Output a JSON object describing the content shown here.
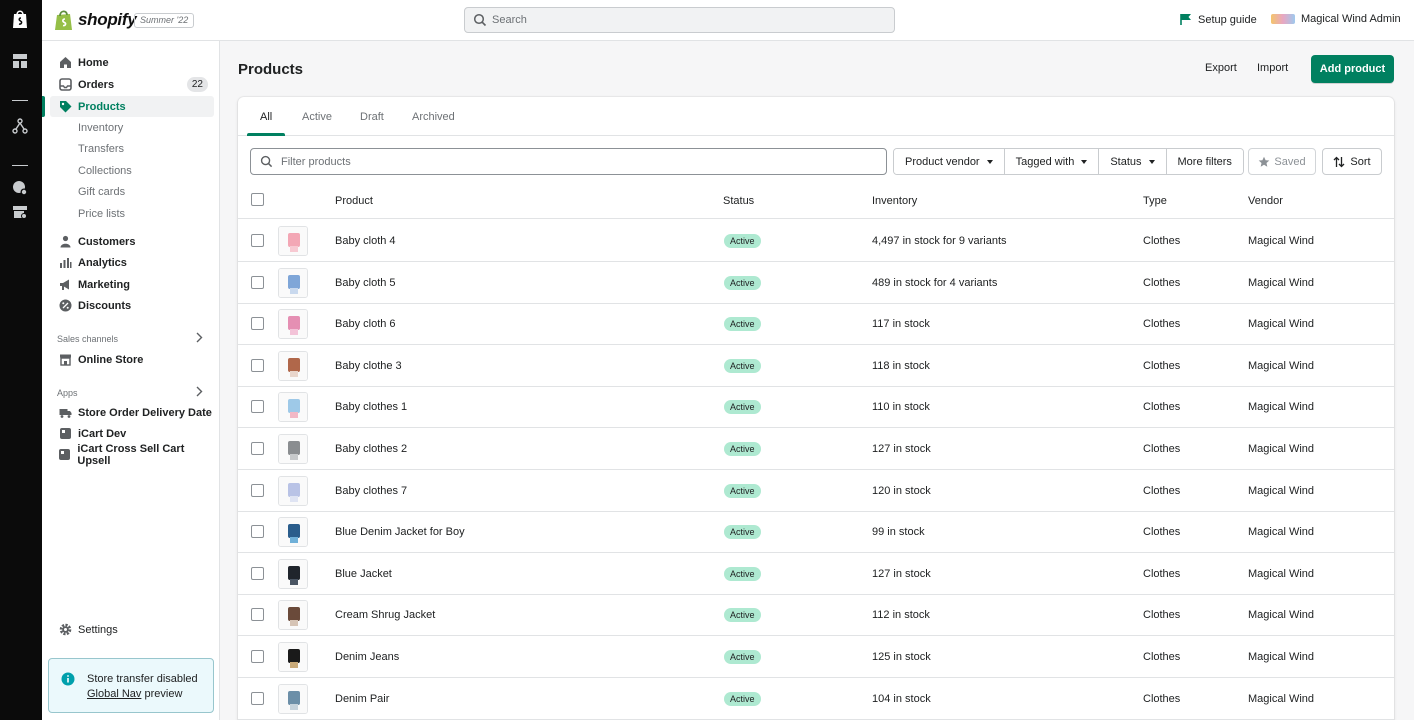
{
  "topbar": {
    "brand": "shopify",
    "edition": "Summer '22",
    "search_placeholder": "Search",
    "setup_guide": "Setup guide",
    "store_name": "Magical Wind Admin"
  },
  "sidebar": {
    "nav": [
      {
        "label": "Home",
        "icon": "home-icon"
      },
      {
        "label": "Orders",
        "icon": "orders-icon",
        "badge": "22"
      },
      {
        "label": "Products",
        "icon": "tag-icon",
        "active": true
      }
    ],
    "product_sub": [
      "Inventory",
      "Transfers",
      "Collections",
      "Gift cards",
      "Price lists"
    ],
    "nav2": [
      {
        "label": "Customers",
        "icon": "person-icon"
      },
      {
        "label": "Analytics",
        "icon": "bar-chart-icon"
      },
      {
        "label": "Marketing",
        "icon": "megaphone-icon"
      },
      {
        "label": "Discounts",
        "icon": "discount-icon"
      }
    ],
    "sales_channels_title": "Sales channels",
    "online_store": "Online Store",
    "apps_title": "Apps",
    "apps": [
      "Store Order Delivery Date",
      "iCart Dev",
      "iCart Cross Sell Cart Upsell"
    ],
    "settings": "Settings",
    "notice": {
      "line1": "Store transfer disabled",
      "link": "Global Nav",
      "rest": " preview"
    }
  },
  "page": {
    "title": "Products",
    "export": "Export",
    "import": "Import",
    "add_product": "Add product"
  },
  "tabs": [
    "All",
    "Active",
    "Draft",
    "Archived"
  ],
  "filters": {
    "placeholder": "Filter products",
    "product_vendor": "Product vendor",
    "tagged_with": "Tagged with",
    "status": "Status",
    "more_filters": "More filters",
    "saved": "Saved",
    "sort": "Sort"
  },
  "table": {
    "headers": {
      "product": "Product",
      "status": "Status",
      "inventory": "Inventory",
      "type": "Type",
      "vendor": "Vendor"
    },
    "rows": [
      {
        "name": "Baby cloth 4",
        "status": "Active",
        "inventory": "4,497 in stock for 9 variants",
        "type": "Clothes",
        "vendor": "Magical Wind"
      },
      {
        "name": "Baby cloth 5",
        "status": "Active",
        "inventory": "489 in stock for 4 variants",
        "type": "Clothes",
        "vendor": "Magical Wind"
      },
      {
        "name": "Baby cloth 6",
        "status": "Active",
        "inventory": "117 in stock",
        "type": "Clothes",
        "vendor": "Magical Wind"
      },
      {
        "name": "Baby clothe 3",
        "status": "Active",
        "inventory": "118 in stock",
        "type": "Clothes",
        "vendor": "Magical Wind"
      },
      {
        "name": "Baby clothes 1",
        "status": "Active",
        "inventory": "110 in stock",
        "type": "Clothes",
        "vendor": "Magical Wind"
      },
      {
        "name": "Baby clothes 2",
        "status": "Active",
        "inventory": "127 in stock",
        "type": "Clothes",
        "vendor": "Magical Wind"
      },
      {
        "name": "Baby clothes 7",
        "status": "Active",
        "inventory": "120 in stock",
        "type": "Clothes",
        "vendor": "Magical Wind"
      },
      {
        "name": "Blue Denim Jacket for Boy",
        "status": "Active",
        "inventory": "99 in stock",
        "type": "Clothes",
        "vendor": "Magical Wind"
      },
      {
        "name": "Blue Jacket",
        "status": "Active",
        "inventory": "127 in stock",
        "type": "Clothes",
        "vendor": "Magical Wind"
      },
      {
        "name": "Cream Shrug Jacket",
        "status": "Active",
        "inventory": "112 in stock",
        "type": "Clothes",
        "vendor": "Magical Wind"
      },
      {
        "name": "Denim Jeans",
        "status": "Active",
        "inventory": "125 in stock",
        "type": "Clothes",
        "vendor": "Magical Wind"
      },
      {
        "name": "Denim Pair",
        "status": "Active",
        "inventory": "104 in stock",
        "type": "Clothes",
        "vendor": "Magical Wind"
      }
    ]
  },
  "colors": {
    "accent": "#008060",
    "active_pill": "#aee9d1",
    "strip": "#0b0b0b"
  }
}
